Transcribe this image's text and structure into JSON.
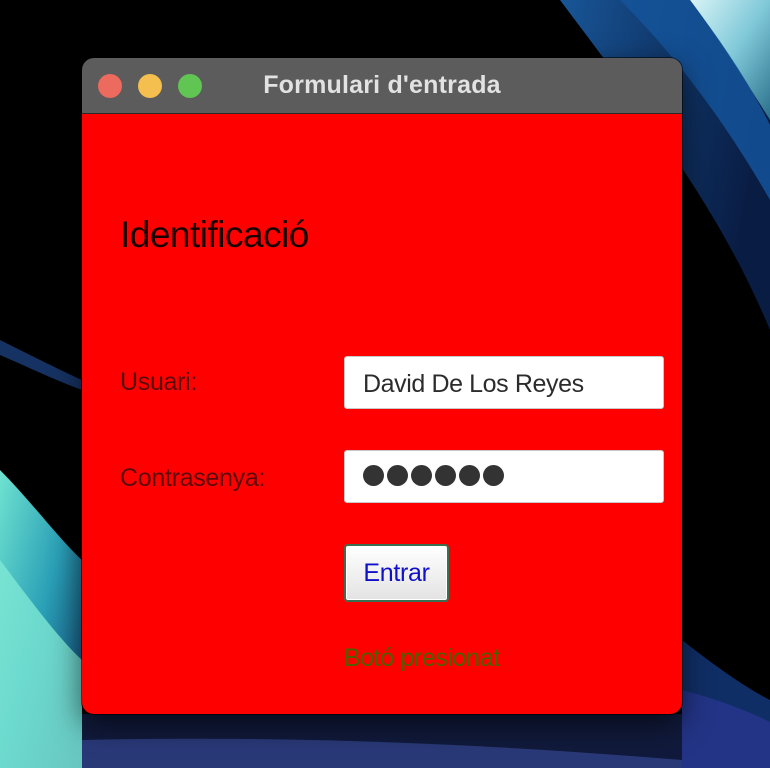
{
  "window": {
    "title": "Formulari d'entrada",
    "background_color": "#ff0000"
  },
  "form": {
    "heading": "Identificació",
    "user_label": "Usuari:",
    "user_value": "David De Los Reyes",
    "password_label": "Contrasenya:",
    "password_mask_length": 6,
    "submit_label": "Entrar",
    "status_text": "Botó presionat"
  }
}
